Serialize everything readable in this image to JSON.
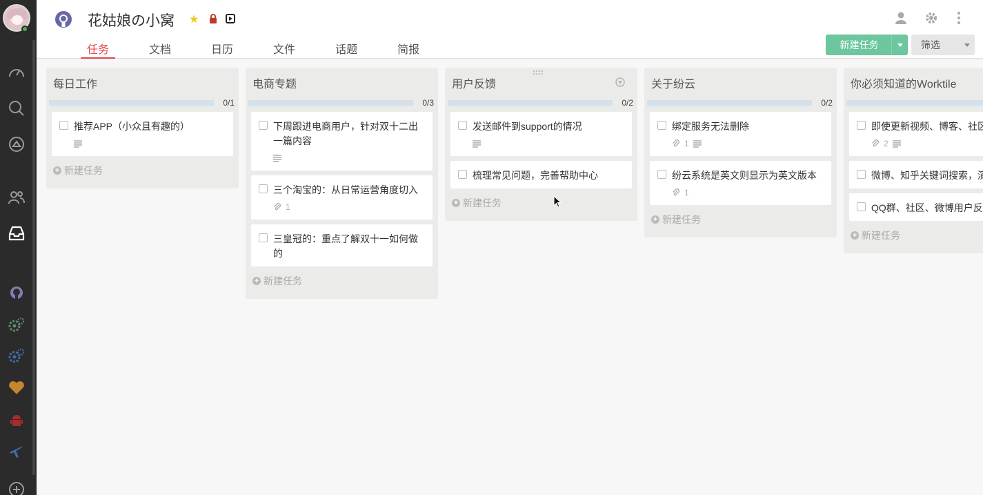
{
  "project": {
    "title": "花姑娘の小窝",
    "logo_icon": "github-icon",
    "colors": {
      "accent": "#e5484d",
      "primary_button": "#6cc69e",
      "sidebar": "#2b2b2b"
    }
  },
  "tabs": [
    {
      "label": "任务",
      "active": true
    },
    {
      "label": "文档"
    },
    {
      "label": "日历"
    },
    {
      "label": "文件"
    },
    {
      "label": "话题"
    },
    {
      "label": "简报"
    }
  ],
  "toolbar": {
    "new_task_label": "新建任务",
    "filter_label": "筛选"
  },
  "sidebar": {
    "icons": [
      "dashboard-icon",
      "search-icon",
      "notification-icon",
      "members-icon",
      "inbox-icon",
      "github-icon",
      "gears-green-icon",
      "gears-blue-icon",
      "heart-icon",
      "android-icon",
      "plane-icon",
      "add-icon"
    ]
  },
  "columns": [
    {
      "title": "每日工作",
      "count": "0/1",
      "add_label": "新建任务",
      "tasks": [
        {
          "text": "推荐APP（小众且有趣的）",
          "desc_icon": true
        }
      ]
    },
    {
      "title": "电商专题",
      "count": "0/3",
      "add_label": "新建任务",
      "tasks": [
        {
          "text": "下周跟进电商用户，针对双十二出一篇内容",
          "desc_icon": true
        },
        {
          "text": "三个淘宝的：从日常运营角度切入",
          "attachments": "1"
        },
        {
          "text": "三皇冠的：重点了解双十一如何做的"
        }
      ]
    },
    {
      "title": "用户反馈",
      "count": "0/2",
      "add_label": "新建任务",
      "tasks": [
        {
          "text": "发送邮件到support的情况",
          "desc_icon": true
        },
        {
          "text": "梳理常见问题，完善帮助中心"
        }
      ]
    },
    {
      "title": "关于纷云",
      "count": "0/2",
      "add_label": "新建任务",
      "tasks": [
        {
          "text": "绑定服务无法删除",
          "attachments": "1",
          "desc_icon": true
        },
        {
          "text": "纷云系统是英文则显示为英文版本",
          "attachments": "1"
        }
      ]
    },
    {
      "title": "你必须知道的Worktile",
      "count": "",
      "add_label": "新建任务",
      "tasks": [
        {
          "text": "即使更新视频、博客、社区",
          "attachments": "2",
          "desc_icon": true
        },
        {
          "text": "微博、知乎关键词搜索，演接"
        },
        {
          "text": "QQ群、社区、微博用户反"
        }
      ]
    }
  ]
}
